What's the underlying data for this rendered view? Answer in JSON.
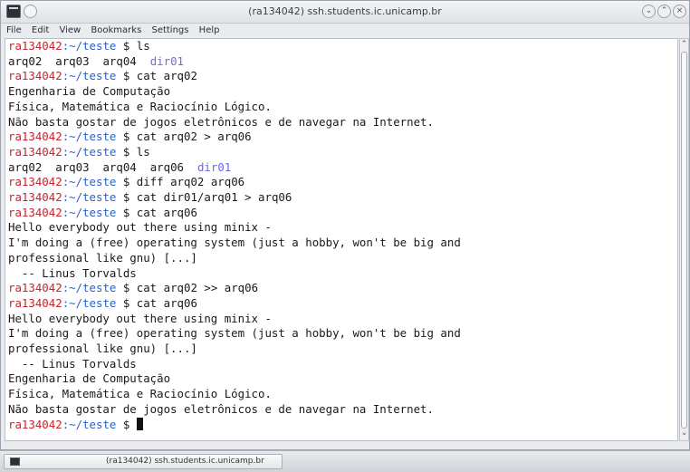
{
  "window": {
    "title": "(ra134042) ssh.students.ic.unicamp.br"
  },
  "menubar": {
    "items": [
      "File",
      "Edit",
      "View",
      "Bookmarks",
      "Settings",
      "Help"
    ]
  },
  "terminal": {
    "prompt_user": "ra134042",
    "prompt_path": ":~/teste",
    "prompt_sign": " $ ",
    "lines": [
      {
        "type": "cmd",
        "text": "ls"
      },
      {
        "type": "ls",
        "files": [
          "arq02",
          "arq03",
          "arq04"
        ],
        "dirs": [
          "dir01"
        ]
      },
      {
        "type": "cmd",
        "text": "cat arq02"
      },
      {
        "type": "out",
        "text": "Engenharia de Computação"
      },
      {
        "type": "out",
        "text": "Física, Matemática e Raciocínio Lógico."
      },
      {
        "type": "out",
        "text": "Não basta gostar de jogos eletrônicos e de navegar na Internet."
      },
      {
        "type": "cmd",
        "text": "cat arq02 > arq06"
      },
      {
        "type": "cmd",
        "text": "ls"
      },
      {
        "type": "ls",
        "files": [
          "arq02",
          "arq03",
          "arq04",
          "arq06"
        ],
        "dirs": [
          "dir01"
        ]
      },
      {
        "type": "cmd",
        "text": "diff arq02 arq06"
      },
      {
        "type": "cmd",
        "text": "cat dir01/arq01 > arq06"
      },
      {
        "type": "cmd",
        "text": "cat arq06"
      },
      {
        "type": "out",
        "text": "Hello everybody out there using minix -"
      },
      {
        "type": "out",
        "text": "I'm doing a (free) operating system (just a hobby, won't be big and"
      },
      {
        "type": "out",
        "text": "professional like gnu) [...]"
      },
      {
        "type": "out",
        "text": "  -- Linus Torvalds"
      },
      {
        "type": "cmd",
        "text": "cat arq02 >> arq06"
      },
      {
        "type": "cmd",
        "text": "cat arq06"
      },
      {
        "type": "out",
        "text": "Hello everybody out there using minix -"
      },
      {
        "type": "out",
        "text": "I'm doing a (free) operating system (just a hobby, won't be big and"
      },
      {
        "type": "out",
        "text": "professional like gnu) [...]"
      },
      {
        "type": "out",
        "text": "  -- Linus Torvalds"
      },
      {
        "type": "out",
        "text": "Engenharia de Computação"
      },
      {
        "type": "out",
        "text": "Física, Matemática e Raciocínio Lógico."
      },
      {
        "type": "out",
        "text": "Não basta gostar de jogos eletrônicos e de navegar na Internet."
      },
      {
        "type": "cursor",
        "text": ""
      }
    ]
  },
  "taskbar": {
    "task_label": "(ra134042) ssh.students.ic.unicamp.br"
  },
  "colors": {
    "prompt_user": "#c0262c",
    "prompt_path": "#2a62c4",
    "directory": "#6b67f0",
    "text": "#1a1a1a",
    "background": "#ffffff"
  },
  "icons": [
    "terminal-app-icon",
    "window-menu-icon",
    "minimize-icon",
    "maximize-icon",
    "close-icon",
    "scroll-up-arrow-icon",
    "scroll-down-arrow-icon",
    "taskbar-terminal-icon"
  ]
}
